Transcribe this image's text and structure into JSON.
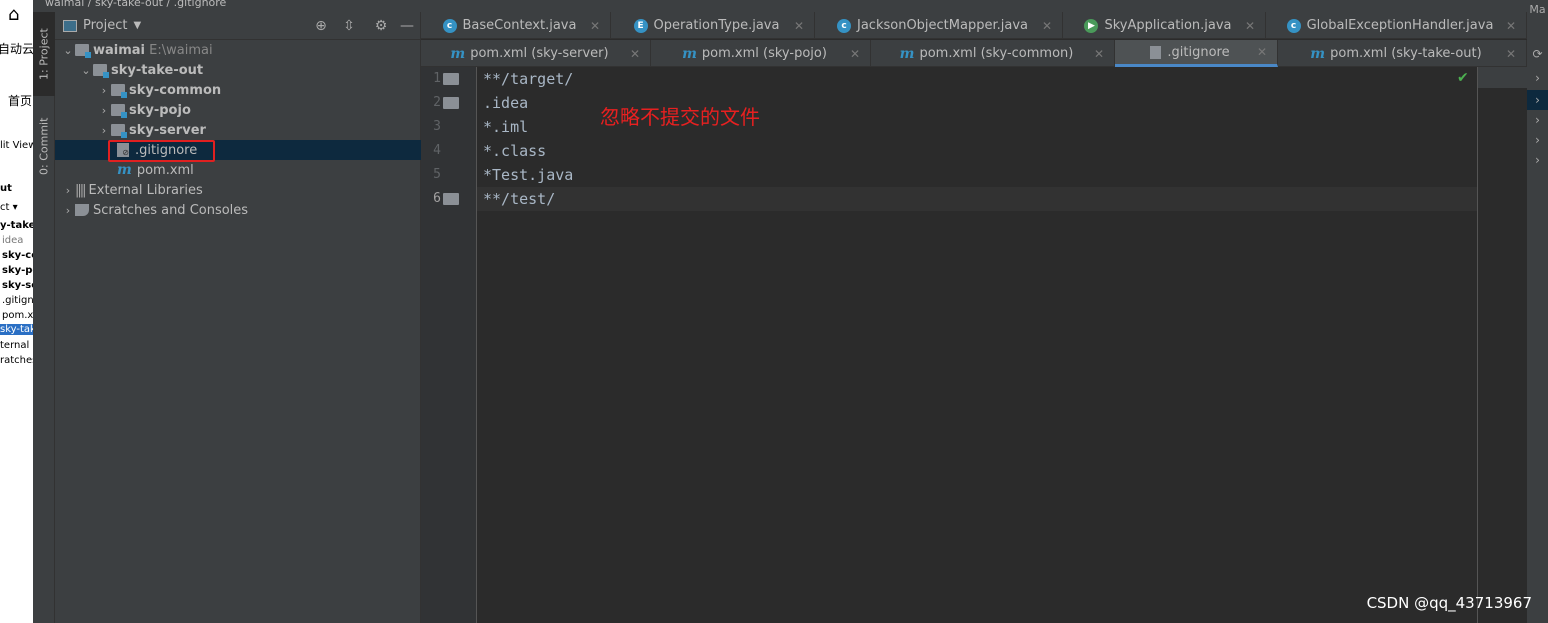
{
  "background_window": {
    "texts": [
      "自动云",
      "首页",
      "lit  View",
      "ut",
      "ct ▾",
      "y-take-",
      "idea",
      "sky-co",
      "sky-po",
      "sky-se",
      ".gitign",
      "pom.xn",
      "sky-tak",
      "ternal Li",
      "ratches"
    ]
  },
  "breadcrumb": "waimai / sky-take-out / .gitignore",
  "toolwindow_strip": {
    "project": "1: Project",
    "commit": "0: Commit"
  },
  "project_panel": {
    "title": "Project",
    "tree": [
      {
        "label": "waimai",
        "hint": "E:\\waimai",
        "level": 0,
        "expanded": true,
        "type": "module"
      },
      {
        "label": "sky-take-out",
        "level": 1,
        "expanded": true,
        "type": "module"
      },
      {
        "label": "sky-common",
        "level": 2,
        "expanded": false,
        "type": "module"
      },
      {
        "label": "sky-pojo",
        "level": 2,
        "expanded": false,
        "type": "module"
      },
      {
        "label": "sky-server",
        "level": 2,
        "expanded": false,
        "type": "module"
      },
      {
        "label": ".gitignore",
        "level": 2,
        "type": "ignore-file",
        "selected": true
      },
      {
        "label": "pom.xml",
        "level": 2,
        "type": "maven"
      },
      {
        "label": "External Libraries",
        "level": 0,
        "expanded": false,
        "type": "libraries"
      },
      {
        "label": "Scratches and Consoles",
        "level": 0,
        "expanded": false,
        "type": "scratches"
      }
    ]
  },
  "tabs_row1": [
    {
      "label": "BaseContext.java",
      "icon": "class"
    },
    {
      "label": "OperationType.java",
      "icon": "enum"
    },
    {
      "label": "JacksonObjectMapper.java",
      "icon": "class"
    },
    {
      "label": "SkyApplication.java",
      "icon": "spring-app"
    },
    {
      "label": "GlobalExceptionHandler.java",
      "icon": "class"
    }
  ],
  "tabs_row2": [
    {
      "label": "pom.xml (sky-server)"
    },
    {
      "label": "pom.xml (sky-pojo)"
    },
    {
      "label": "pom.xml (sky-common)"
    },
    {
      "label": ".gitignore",
      "active": true
    },
    {
      "label": "pom.xml (sky-take-out)"
    }
  ],
  "editor": {
    "lines": [
      "**/target/",
      ".idea",
      "*.iml",
      "*.class",
      "*Test.java",
      "**/test/"
    ],
    "current_line": 6
  },
  "annotation": "忽略不提交的文件",
  "right_tab": "Ma",
  "watermark": "CSDN @qq_43713967",
  "colors": {
    "accent": "#4a88c7",
    "annotation": "#e82020",
    "selection": "#0d293e"
  }
}
